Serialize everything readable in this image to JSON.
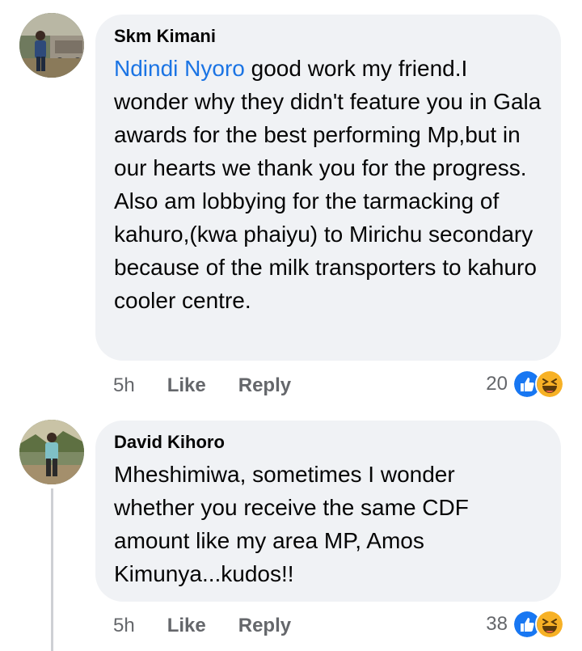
{
  "comments": [
    {
      "author": "Skm Kimani",
      "mention": "Ndindi Nyoro",
      "text": " good work my friend.I wonder why they didn't feature you in Gala awards for the best performing Mp,but in our hearts we thank you for the progress.\nAlso am lobbying for the tarmacking of kahuro,(kwa phaiyu) to Mirichu secondary because of the milk transporters to kahuro cooler  centre.",
      "time": "5h",
      "like_label": "Like",
      "reply_label": "Reply",
      "reaction_count": "20",
      "reactions": [
        "like-icon",
        "haha-icon"
      ]
    },
    {
      "author": "David Kihoro",
      "text": "Mheshimiwa, sometimes I wonder whether you receive the same CDF amount like my area MP, Amos Kimunya...kudos!!",
      "time": "5h",
      "like_label": "Like",
      "reply_label": "Reply",
      "reaction_count": "38",
      "reactions": [
        "like-icon",
        "haha-icon"
      ]
    }
  ],
  "colors": {
    "bubble": "#f0f2f5",
    "mention": "#1b74e4",
    "meta": "#65676b",
    "like_blue": "#1877f2",
    "haha_yellow": "#f7b125"
  }
}
